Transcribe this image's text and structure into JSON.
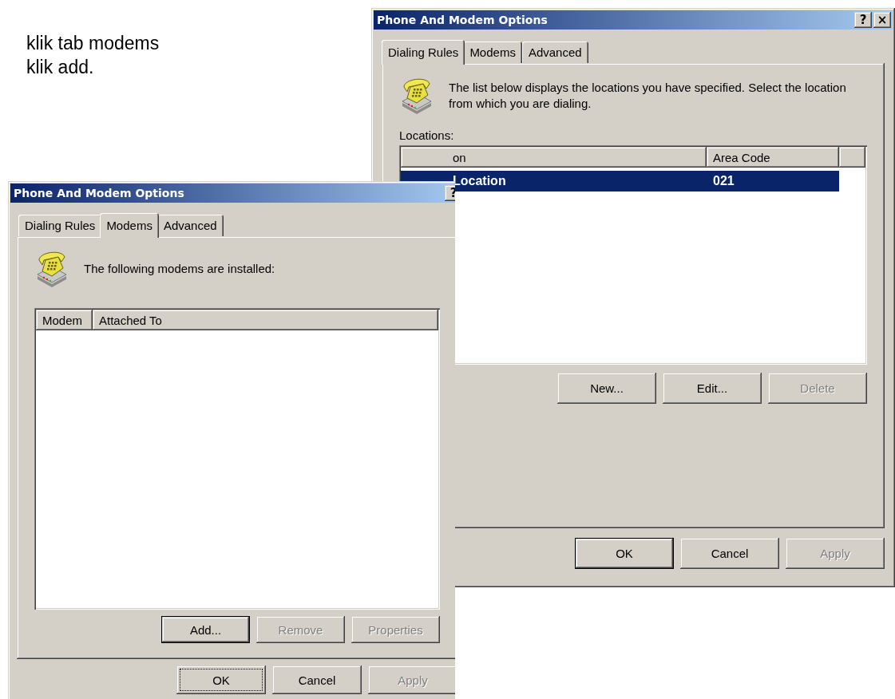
{
  "note": {
    "lines": [
      "klik tab modems",
      "klik add."
    ]
  },
  "dialing_window": {
    "title": "Phone And Modem Options",
    "title_buttons": [
      "?",
      "×"
    ],
    "tabs": [
      {
        "label": "Dialing Rules",
        "selected": true
      },
      {
        "label": "Modems",
        "selected": false
      },
      {
        "label": "Advanced",
        "selected": false
      }
    ],
    "description": "The list below displays the locations you have specified. Select the location from which you are dialing.",
    "list_label": "Locations:",
    "columns": [
      "on",
      "Area Code"
    ],
    "rows": [
      {
        "cells": [
          "Location",
          "021"
        ],
        "selected": true
      }
    ],
    "list_buttons": [
      {
        "label": "New...",
        "disabled": false,
        "default": false,
        "focused": false
      },
      {
        "label": "Edit...",
        "disabled": false,
        "default": false,
        "focused": false
      },
      {
        "label": "Delete",
        "disabled": true,
        "default": false,
        "focused": false
      }
    ],
    "dialog_buttons": [
      {
        "label": "OK",
        "disabled": false,
        "default": true,
        "focused": false
      },
      {
        "label": "Cancel",
        "disabled": false,
        "default": false,
        "focused": false
      },
      {
        "label": "Apply",
        "disabled": true,
        "default": false,
        "focused": false
      }
    ]
  },
  "modems_window": {
    "title": "Phone And Modem Options",
    "title_buttons": [
      "?"
    ],
    "tabs": [
      {
        "label": "Dialing Rules",
        "selected": false
      },
      {
        "label": "Modems",
        "selected": true
      },
      {
        "label": "Advanced",
        "selected": false
      }
    ],
    "description": "The following modems are  installed:",
    "columns": [
      "Modem",
      "Attached To"
    ],
    "list_buttons": [
      {
        "label": "Add...",
        "disabled": false,
        "default": true,
        "focused": false
      },
      {
        "label": "Remove",
        "disabled": true,
        "default": false,
        "focused": false
      },
      {
        "label": "Properties",
        "disabled": true,
        "default": false,
        "focused": false
      }
    ],
    "dialog_buttons": [
      {
        "label": "OK",
        "disabled": false,
        "default": false,
        "focused": true
      },
      {
        "label": "Cancel",
        "disabled": false,
        "default": false,
        "focused": false
      },
      {
        "label": "Apply",
        "disabled": true,
        "default": false,
        "focused": false
      }
    ]
  }
}
